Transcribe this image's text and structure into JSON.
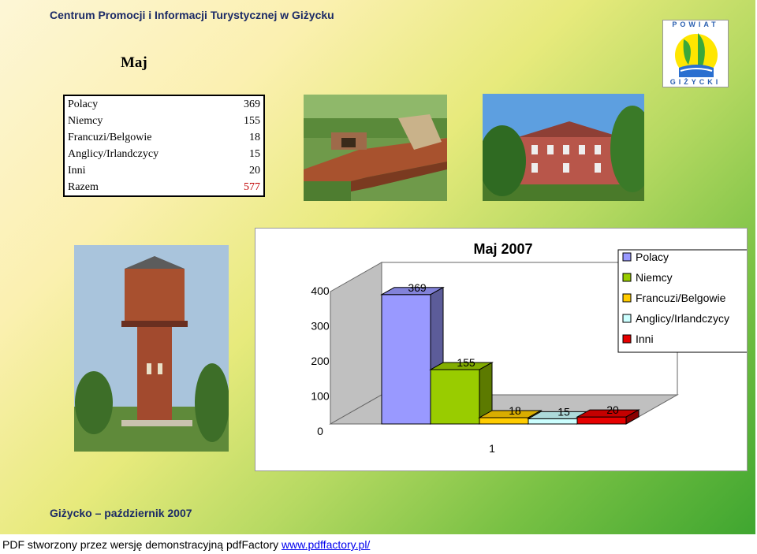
{
  "header": {
    "title": "Centrum Promocji i Informacji Turystycznej w Giżycku"
  },
  "month": "Maj",
  "logo": {
    "top_text": "POWIAT",
    "bottom_text": "GIŻYCKI"
  },
  "stats_table": {
    "rows": [
      {
        "label": "Polacy",
        "value": "369"
      },
      {
        "label": "Niemcy",
        "value": "155"
      },
      {
        "label": "Francuzi/Belgowie",
        "value": "18"
      },
      {
        "label": "Anglicy/Irlandczycy",
        "value": "15"
      },
      {
        "label": "Inni",
        "value": "20"
      },
      {
        "label": "Razem",
        "value": "577"
      }
    ]
  },
  "chart_data": {
    "type": "bar",
    "title": "Maj 2007",
    "categories": [
      "1"
    ],
    "series": [
      {
        "name": "Polacy",
        "values": [
          369
        ],
        "color": "#9999ff"
      },
      {
        "name": "Niemcy",
        "values": [
          155
        ],
        "color": "#99cc00"
      },
      {
        "name": "Francuzi/Belgowie",
        "values": [
          18
        ],
        "color": "#ffcc00"
      },
      {
        "name": "Anglicy/Irlandczycy",
        "values": [
          15
        ],
        "color": "#ccffff"
      },
      {
        "name": "Inni",
        "values": [
          20
        ],
        "color": "#e60000"
      }
    ],
    "y_ticks": [
      "0",
      "100",
      "200",
      "300",
      "400"
    ],
    "ylim": [
      0,
      400
    ],
    "legend_position": "right",
    "three_d": true
  },
  "footer": {
    "place_date": "Giżycko – październik 2007"
  },
  "pdf_bar": {
    "text": "PDF stworzony przez wersję demonstracyjną pdfFactory ",
    "link": "www.pdffactory.pl/"
  }
}
